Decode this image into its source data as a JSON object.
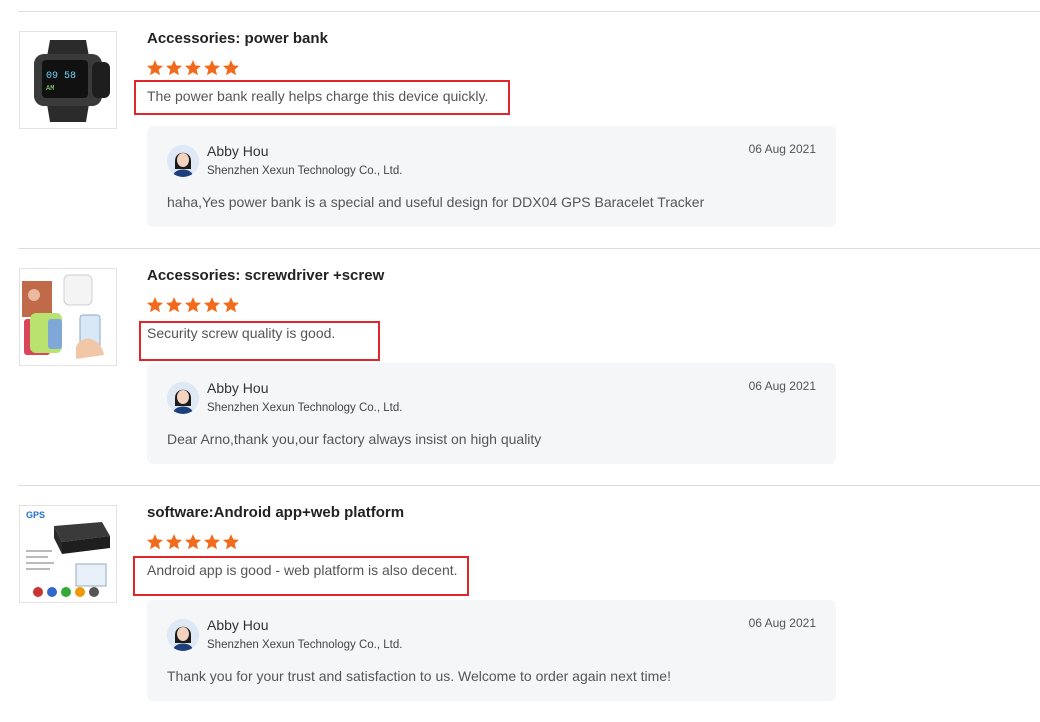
{
  "reviews": [
    {
      "product_title": "Accessories: power bank",
      "rating": 5,
      "comment": "The power bank really helps charge this device quickly.",
      "reply": {
        "name": "Abby Hou",
        "company": "Shenzhen Xexun Technology Co., Ltd.",
        "date": "06 Aug 2021",
        "text": "haha,Yes power bank is a special and useful  design for DDX04  GPS Baracelet Tracker"
      }
    },
    {
      "product_title": "Accessories: screwdriver +screw",
      "rating": 5,
      "comment": "Security screw quality is good.",
      "reply": {
        "name": "Abby Hou",
        "company": "Shenzhen Xexun Technology Co., Ltd.",
        "date": "06 Aug 2021",
        "text": "Dear Arno,thank you,our factory always insist on high quality"
      }
    },
    {
      "product_title": "software:Android app+web platform",
      "rating": 5,
      "comment": "Android app is good - web platform is also decent.",
      "reply": {
        "name": "Abby Hou",
        "company": "Shenzhen Xexun Technology Co., Ltd.",
        "date": "06 Aug 2021",
        "text": "Thank you for your trust and satisfaction to us. Welcome to order again next time!"
      }
    }
  ],
  "thumbnails": {
    "watch_screen_top": "09 58",
    "watch_screen_bottom": "AM",
    "gps_logo": "GPS"
  },
  "colors": {
    "star": "#f26b1d",
    "highlight_border": "#e0262b",
    "reply_background": "#f5f6f8"
  },
  "icons": [
    "star-icon",
    "avatar"
  ]
}
